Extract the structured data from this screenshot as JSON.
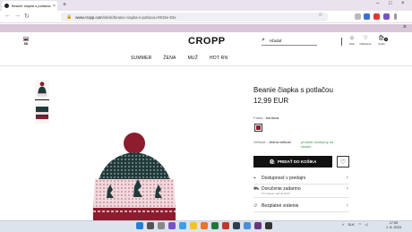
{
  "browser": {
    "tab_title": "Beanie čiapka s potlačou Farba",
    "url_host": "www.cropp.com",
    "url_path": "/sk/sk/beanie-ciapka-s-potlacou-9915e-83x"
  },
  "header": {
    "country": "SK",
    "logo": "CROPP",
    "search_placeholder": "Hľadať",
    "icons": [
      {
        "label": "Účet"
      },
      {
        "label": "Obľúbené"
      },
      {
        "label": "Košík"
      }
    ],
    "cart_count": "0"
  },
  "nav": [
    "SUMMER",
    "ŽENA",
    "MUŽ",
    "HOT RN"
  ],
  "product": {
    "title": "Beanie čiapka s potlačou",
    "price": "12,99 EUR",
    "color_label": "Farba",
    "color_value": "bordová",
    "swatch_color": "#8c1d2e",
    "size_label": "Veľkosť",
    "size_value": "Jedna veľkosť",
    "stock": "produkt dostupný na sklade",
    "add_to_cart": "PRIDAŤ DO KOŠÍKA"
  },
  "info": [
    {
      "label": "Dostupnosť v predajni",
      "sub": ""
    },
    {
      "label": "Doručenie zadarmo",
      "sub": "Pri nákupe nad 40 EUR"
    },
    {
      "label": "Bezplatné vrátenie",
      "sub": ""
    }
  ],
  "taskbar": {
    "lang": "SLK",
    "time": "17:59",
    "date": "1. 8. 2023"
  }
}
